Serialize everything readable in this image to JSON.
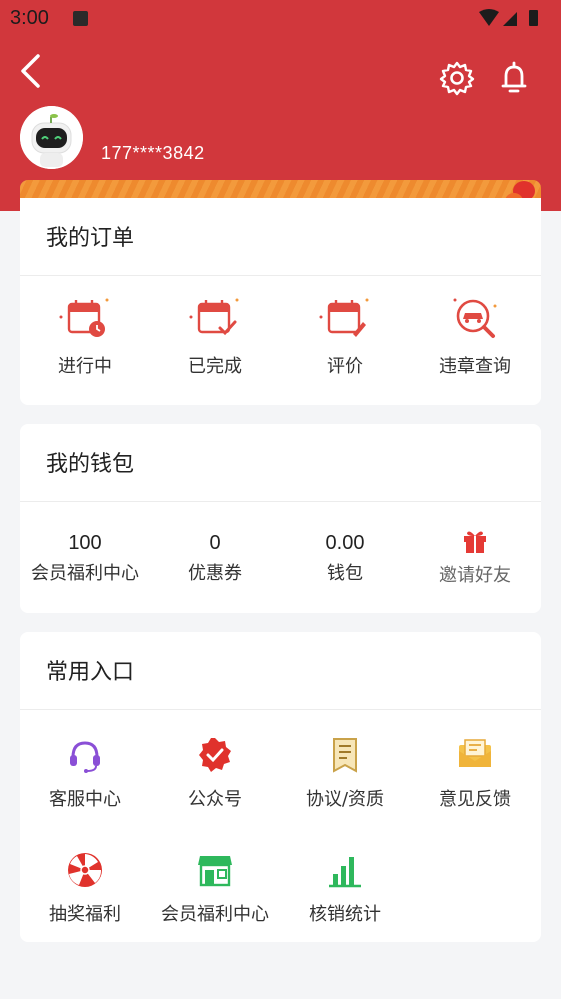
{
  "status": {
    "time": "3:00"
  },
  "user": {
    "phone": "177****3842"
  },
  "orders": {
    "title": "我的订单",
    "items": [
      {
        "label": "进行中",
        "icon": "calendar-clock-icon"
      },
      {
        "label": "已完成",
        "icon": "calendar-check-icon"
      },
      {
        "label": "评价",
        "icon": "calendar-pen-icon"
      },
      {
        "label": "违章查询",
        "icon": "car-search-icon"
      }
    ]
  },
  "wallet": {
    "title": "我的钱包",
    "items": [
      {
        "value": "100",
        "label": "会员福利中心"
      },
      {
        "value": "0",
        "label": "优惠券"
      },
      {
        "value": "0.00",
        "label": "钱包"
      },
      {
        "label": "邀请好友",
        "icon": "gift-icon"
      }
    ]
  },
  "shortcuts": {
    "title": "常用入口",
    "items": [
      {
        "label": "客服中心",
        "icon": "headset-icon"
      },
      {
        "label": "公众号",
        "icon": "badge-icon"
      },
      {
        "label": "协议/资质",
        "icon": "document-icon"
      },
      {
        "label": "意见反馈",
        "icon": "mail-icon"
      },
      {
        "label": "抽奖福利",
        "icon": "lottery-wheel-icon"
      },
      {
        "label": "会员福利中心",
        "icon": "store-icon"
      },
      {
        "label": "核销统计",
        "icon": "bar-chart-icon"
      }
    ]
  },
  "colors": {
    "brand": "#d1373c",
    "accent_orange": "#f39a3c",
    "purple": "#8a4fd6",
    "green": "#2eb85c",
    "gold": "#f4c24a"
  }
}
